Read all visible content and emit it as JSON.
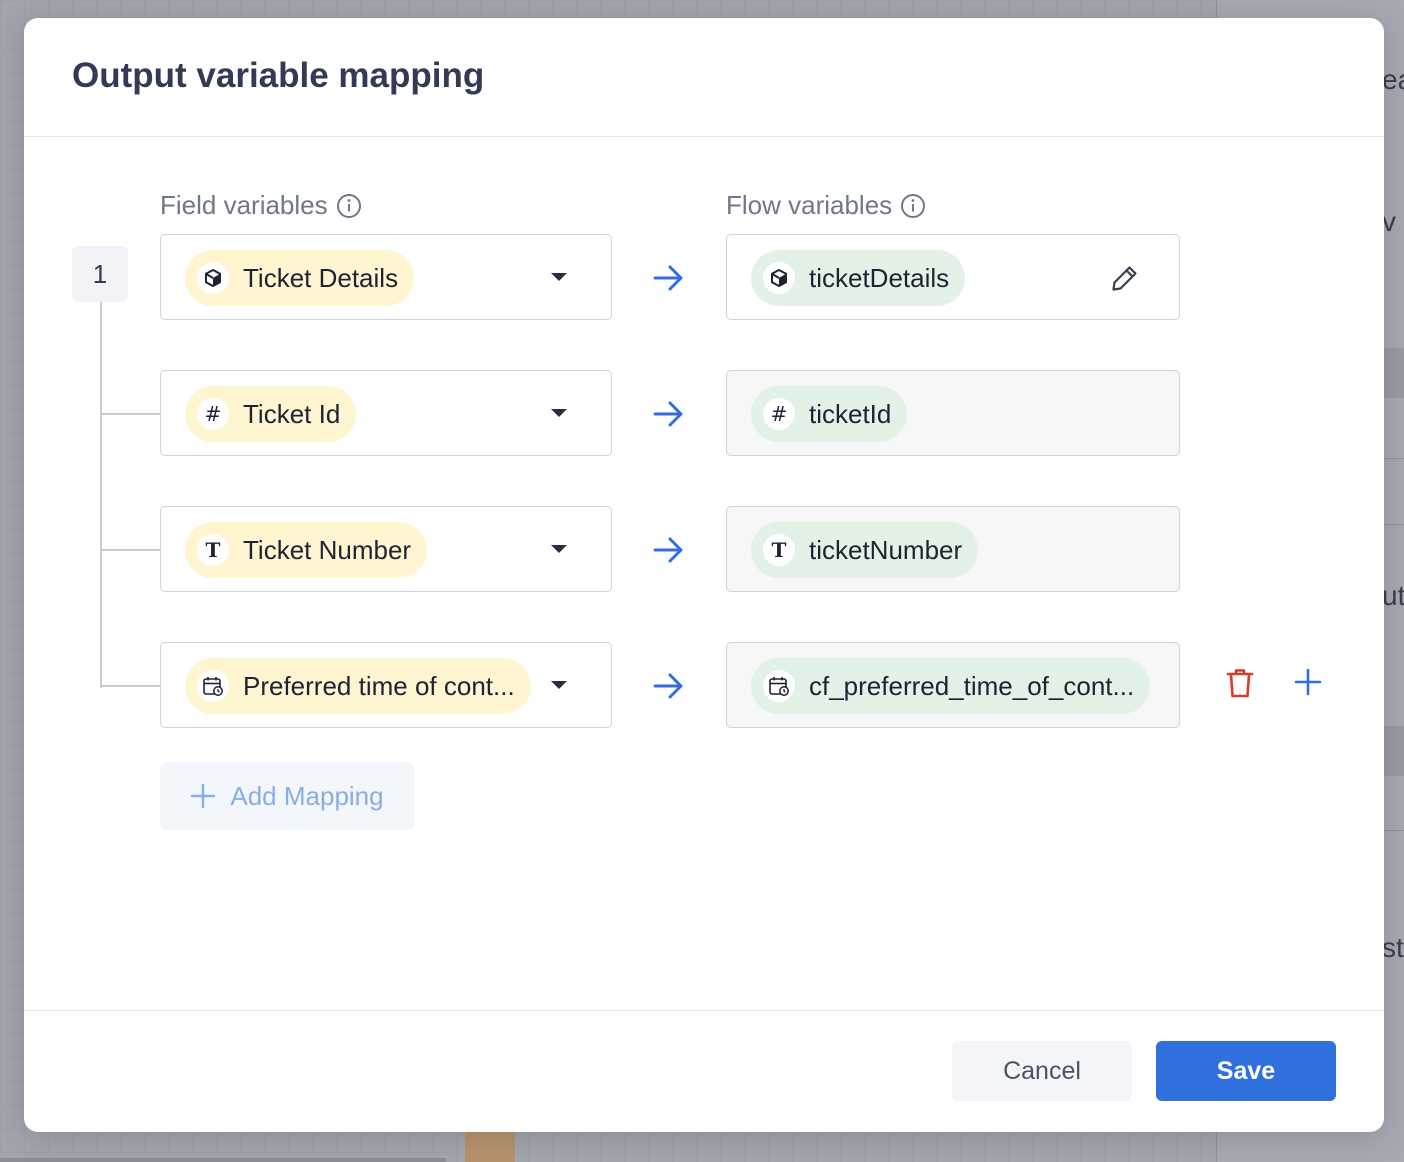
{
  "modal": {
    "title": "Output variable mapping",
    "field_column_label": "Field variables",
    "flow_column_label": "Flow variables",
    "row_number": "1"
  },
  "mappings": [
    {
      "field": {
        "label": "Ticket Details",
        "icon": "cube-icon"
      },
      "flow": {
        "label": "ticketDetails",
        "icon": "cube-icon",
        "editable": true
      }
    },
    {
      "field": {
        "label": "Ticket Id",
        "icon": "hash-icon",
        "glyph": "#"
      },
      "flow": {
        "label": "ticketId",
        "icon": "hash-icon",
        "glyph": "#",
        "editable": false
      }
    },
    {
      "field": {
        "label": "Ticket Number",
        "icon": "text-type-icon",
        "glyph": "T"
      },
      "flow": {
        "label": "ticketNumber",
        "icon": "text-type-icon",
        "glyph": "T",
        "editable": false
      }
    },
    {
      "field": {
        "label": "Preferred time of cont...",
        "icon": "calendar-clock-icon"
      },
      "flow": {
        "label": "cf_preferred_time_of_cont...",
        "icon": "calendar-clock-icon",
        "editable": false
      }
    }
  ],
  "actions": {
    "add_mapping_label": "Add Mapping",
    "cancel_label": "Cancel",
    "save_label": "Save"
  },
  "colors": {
    "primary": "#2f6fde",
    "field_pill": "#fff5d1",
    "flow_pill": "#e3f2e6",
    "delete": "#d93a2b",
    "title": "#323a55"
  }
}
